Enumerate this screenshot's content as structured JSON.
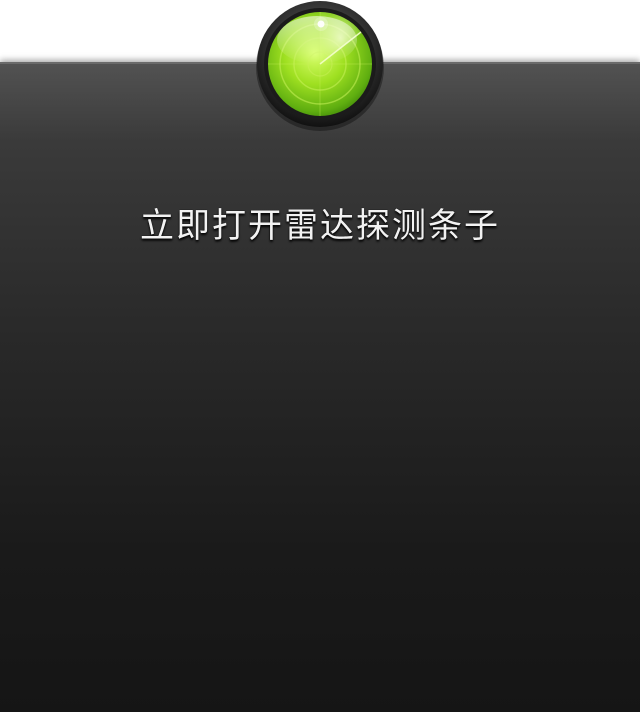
{
  "title": "立即打开雷达探测条子",
  "icon": "radar-icon",
  "colors": {
    "radar_green": "#8fdc1e",
    "panel_dark": "#151515",
    "panel_top": "#525252",
    "text": "#f2f2f2"
  }
}
